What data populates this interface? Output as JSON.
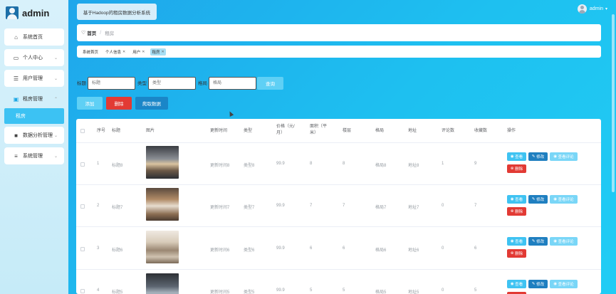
{
  "app": {
    "name": "admin",
    "system_title": "基于Hadoop的租房数据分析系统"
  },
  "user": {
    "name": "admin"
  },
  "sidebar": {
    "items": [
      {
        "label": "系统首页",
        "icon": "home-icon"
      },
      {
        "label": "个人中心",
        "icon": "user-card-icon"
      },
      {
        "label": "用户管理",
        "icon": "list-icon"
      },
      {
        "label": "租房管理",
        "icon": "monitor-icon"
      },
      {
        "label": "数据分析管理",
        "icon": "grid-icon"
      },
      {
        "label": "系统管理",
        "icon": "sliders-icon"
      }
    ],
    "active_sub": "租房"
  },
  "breadcrumb": {
    "home": "首页",
    "current": "租房"
  },
  "tags": [
    {
      "label": "系统首页",
      "closable": false
    },
    {
      "label": "个人信息",
      "closable": true
    },
    {
      "label": "用户",
      "closable": true
    },
    {
      "label": "租房",
      "closable": true,
      "active": true
    }
  ],
  "search": {
    "title_label": "标题",
    "title_placeholder": "标题",
    "type_label": "类型",
    "type_placeholder": "类型",
    "layout_label": "格局",
    "layout_placeholder": "格局",
    "query_button": "查询"
  },
  "actions": {
    "add": "添加",
    "delete": "删除",
    "fetch": "爬取数据"
  },
  "table": {
    "headers": [
      "序号",
      "标题",
      "图片",
      "更新时间",
      "类型",
      "价格（元/月）",
      "面积（平米）",
      "楼层",
      "格局",
      "地址",
      "评论数",
      "收藏数",
      "操作"
    ],
    "rows": [
      {
        "no": "1",
        "title": "标题8",
        "time": "更新时间8",
        "type": "类型8",
        "price": "99.9",
        "area": "8",
        "floor": "8",
        "layout": "格局8",
        "address": "地址8",
        "comments": "1",
        "favorites": "9"
      },
      {
        "no": "2",
        "title": "标题7",
        "time": "更新时间7",
        "type": "类型7",
        "price": "99.9",
        "area": "7",
        "floor": "7",
        "layout": "格局7",
        "address": "地址7",
        "comments": "0",
        "favorites": "7"
      },
      {
        "no": "3",
        "title": "标题6",
        "time": "更新时间6",
        "type": "类型6",
        "price": "99.9",
        "area": "6",
        "floor": "6",
        "layout": "格局6",
        "address": "地址6",
        "comments": "0",
        "favorites": "6"
      },
      {
        "no": "4",
        "title": "标题5",
        "time": "更新时间5",
        "type": "类型5",
        "price": "99.9",
        "area": "5",
        "floor": "5",
        "layout": "格局5",
        "address": "地址5",
        "comments": "0",
        "favorites": "5"
      }
    ],
    "row_actions": {
      "view": "查看",
      "edit": "修改",
      "review": "查看评论",
      "delete": "删除"
    }
  },
  "colors": {
    "accent": "#3cc2f3",
    "danger": "#e23a34",
    "primary_dark": "#1a86c8",
    "background": "#1ec0f0"
  }
}
